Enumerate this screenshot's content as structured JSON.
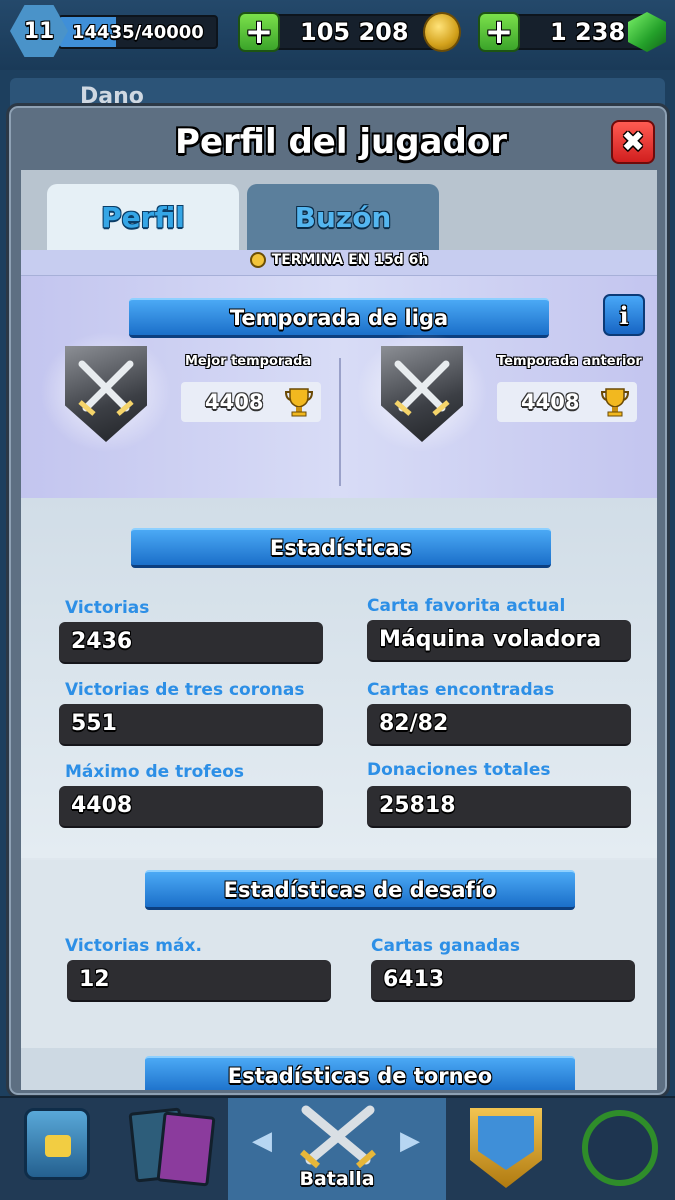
{
  "top_bar": {
    "level": "11",
    "xp_text": "14435/40000",
    "xp_fraction": 0.36,
    "gold": "105 208",
    "gems": "1 238"
  },
  "behind": {
    "name": "Dano"
  },
  "modal": {
    "title": "Perfil del jugador",
    "close_symbol": "✖",
    "tabs": [
      {
        "label": "Perfil"
      },
      {
        "label": "Buzón"
      }
    ],
    "peek_text": "TERMINA EN 15d 6h"
  },
  "league": {
    "title": "Temporada de liga",
    "info_symbol": "i",
    "best": {
      "label": "Mejor temporada",
      "value": "4408"
    },
    "previous": {
      "label": "Temporada anterior",
      "value": "4408"
    }
  },
  "stats": {
    "title": "Estadísticas",
    "left": [
      {
        "label": "Victorias",
        "value": "2436"
      },
      {
        "label": "Victorias de tres coronas",
        "value": "551"
      },
      {
        "label": "Máximo de trofeos",
        "value": "4408"
      }
    ],
    "right": [
      {
        "label": "Carta favorita actual",
        "value": "Máquina voladora"
      },
      {
        "label": "Cartas encontradas",
        "value": "82/82"
      },
      {
        "label": "Donaciones totales",
        "value": "25818"
      }
    ]
  },
  "challenge": {
    "title": "Estadísticas de desafío",
    "items": [
      {
        "label": "Victorias máx.",
        "value": "12"
      },
      {
        "label": "Cartas ganadas",
        "value": "6413"
      }
    ]
  },
  "tournament": {
    "title": "Estadísticas de torneo"
  },
  "bottom_nav": {
    "battle_label": "Batalla",
    "left_arrow": "◀",
    "right_arrow": "▶"
  },
  "colors": {
    "accent_blue": "#2d8fe6",
    "close_red": "#d11f1f",
    "plus_green": "#3ba42a",
    "value_box": "#2d2d31"
  },
  "icons": [
    "shield-level-icon",
    "plus-icon",
    "gold-coin-icon",
    "gem-icon",
    "close-icon",
    "info-icon",
    "league-shield-icon",
    "trophy-icon",
    "chest-icon",
    "cards-icon",
    "battle-swords-icon",
    "clan-icon",
    "tournament-icon"
  ]
}
